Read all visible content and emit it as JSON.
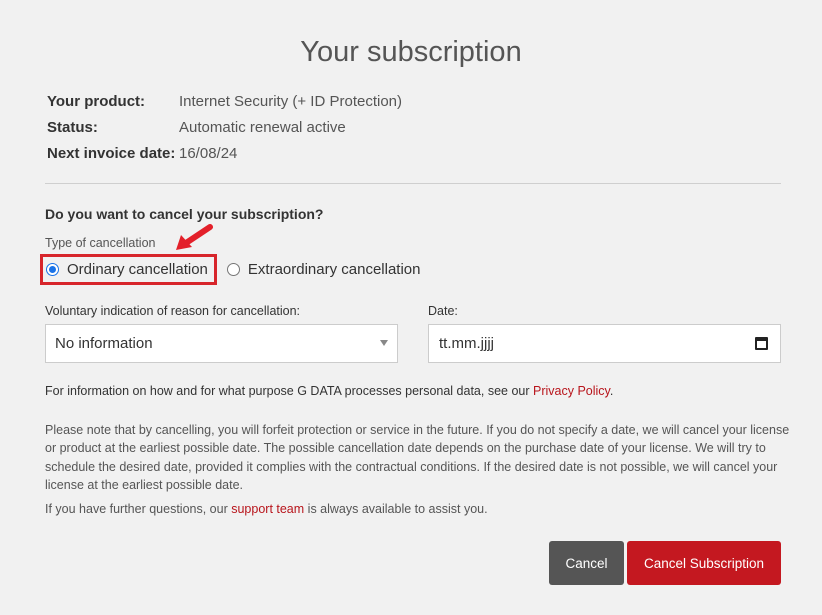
{
  "title": "Your subscription",
  "info": {
    "product_label": "Your product:",
    "product_value": "Internet Security (+ ID Protection)",
    "status_label": "Status:",
    "status_value": "Automatic renewal active",
    "invoice_label": "Next invoice date:",
    "invoice_value": "16/08/24"
  },
  "cancel_form": {
    "question": "Do you want to cancel your subscription?",
    "type_label": "Type of cancellation",
    "options": [
      {
        "label": "Ordinary cancellation",
        "selected": true
      },
      {
        "label": "Extraordinary cancellation",
        "selected": false
      }
    ],
    "reason_label": "Voluntary indication of reason for cancellation:",
    "reason_value": "No information",
    "date_label": "Date:",
    "date_placeholder": "tt.mm.jjjj"
  },
  "privacy": {
    "text_before": "For information on how and for what purpose G DATA processes personal data, see our ",
    "link": "Privacy Policy",
    "text_after": "."
  },
  "notice": "Please note that by cancelling, you will forfeit protection or service in the future. If you do not specify a date, we will cancel your license or product at the earliest possible date. The possible cancellation date depends on the purchase date of your license. We will try to schedule the desired date, provided it complies with the contractual conditions. If the desired date is not possible, we will cancel your license at the earliest possible date.",
  "further": {
    "text_before": "If you have further questions, our ",
    "link": "support team",
    "text_after": " is always available to assist you."
  },
  "buttons": {
    "cancel": "Cancel",
    "cancel_subscription": "Cancel Subscription"
  },
  "colors": {
    "accent_red": "#c41820",
    "highlight_red": "#d7252b",
    "radio_blue": "#1a73e8",
    "cancel_gray": "#555555"
  }
}
